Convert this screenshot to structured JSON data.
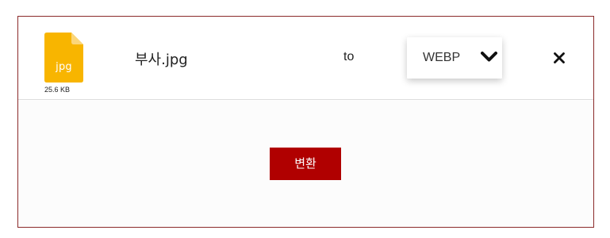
{
  "file": {
    "extension": "jpg",
    "size": "25.6 KB",
    "name": "부사.jpg",
    "icon": "jpg-file-icon",
    "icon_color": "#f8b500"
  },
  "conversion": {
    "to_label": "to",
    "target_format": "WEBP"
  },
  "actions": {
    "convert_label": "변환",
    "convert_color": "#b00000",
    "remove_icon": "close-icon"
  },
  "colors": {
    "frame_border": "#8b2a2a"
  }
}
